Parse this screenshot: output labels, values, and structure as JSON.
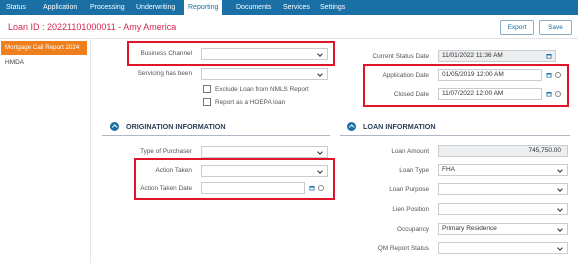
{
  "nav": {
    "tabs": [
      "Status",
      "Application",
      "Processing",
      "Underwriting",
      "Reporting",
      "Documents",
      "Services",
      "Settings"
    ],
    "active": "Reporting"
  },
  "header": {
    "title": "Loan ID : 20221101000011  - Amy America",
    "export_label": "Export",
    "save_label": "Save"
  },
  "sidebar": {
    "items": [
      {
        "label": "Mortgage Call Report 2024",
        "active": true
      },
      {
        "label": "HMDA",
        "active": false
      }
    ]
  },
  "top_left": {
    "business_channel": {
      "label": "Business Channel",
      "value": ""
    },
    "servicing": {
      "label": "Servicing has been",
      "value": ""
    },
    "exclude_nmls": {
      "label": "Exclude Loan from NMLS Report",
      "checked": false
    },
    "report_hoepa": {
      "label": "Report as a HOEPA loan",
      "checked": false
    }
  },
  "top_right": {
    "current_status_date": {
      "label": "Current Status Date",
      "value": "11/01/2022 11:36 AM"
    },
    "application_date": {
      "label": "Application Date",
      "value": "01/05/2019 12:00 AM"
    },
    "closed_date": {
      "label": "Closed Date",
      "value": "11/07/2022 12:00 AM"
    }
  },
  "origination": {
    "title": "ORIGINATION INFORMATION",
    "type_of_purchaser": {
      "label": "Type of Purchaser",
      "value": ""
    },
    "action_taken": {
      "label": "Action Taken",
      "value": ""
    },
    "action_taken_date": {
      "label": "Action Taken Date",
      "value": ""
    }
  },
  "loan_info": {
    "title": "LOAN INFORMATION",
    "loan_amount": {
      "label": "Loan Amount",
      "value": "745,750.00"
    },
    "loan_type": {
      "label": "Loan Type",
      "value": "FHA"
    },
    "loan_purpose": {
      "label": "Loan Purpose",
      "value": ""
    },
    "lien_position": {
      "label": "Lien Position",
      "value": ""
    },
    "occupancy": {
      "label": "Occupancy",
      "value": "Primary Residence"
    },
    "qm_report_status": {
      "label": "QM Report Status",
      "value": ""
    }
  },
  "colors": {
    "nav_bg": "#1a6fa4",
    "title_red": "#d0284f",
    "sidebar_active": "#ef7e1c",
    "highlight": "#e0152a"
  }
}
